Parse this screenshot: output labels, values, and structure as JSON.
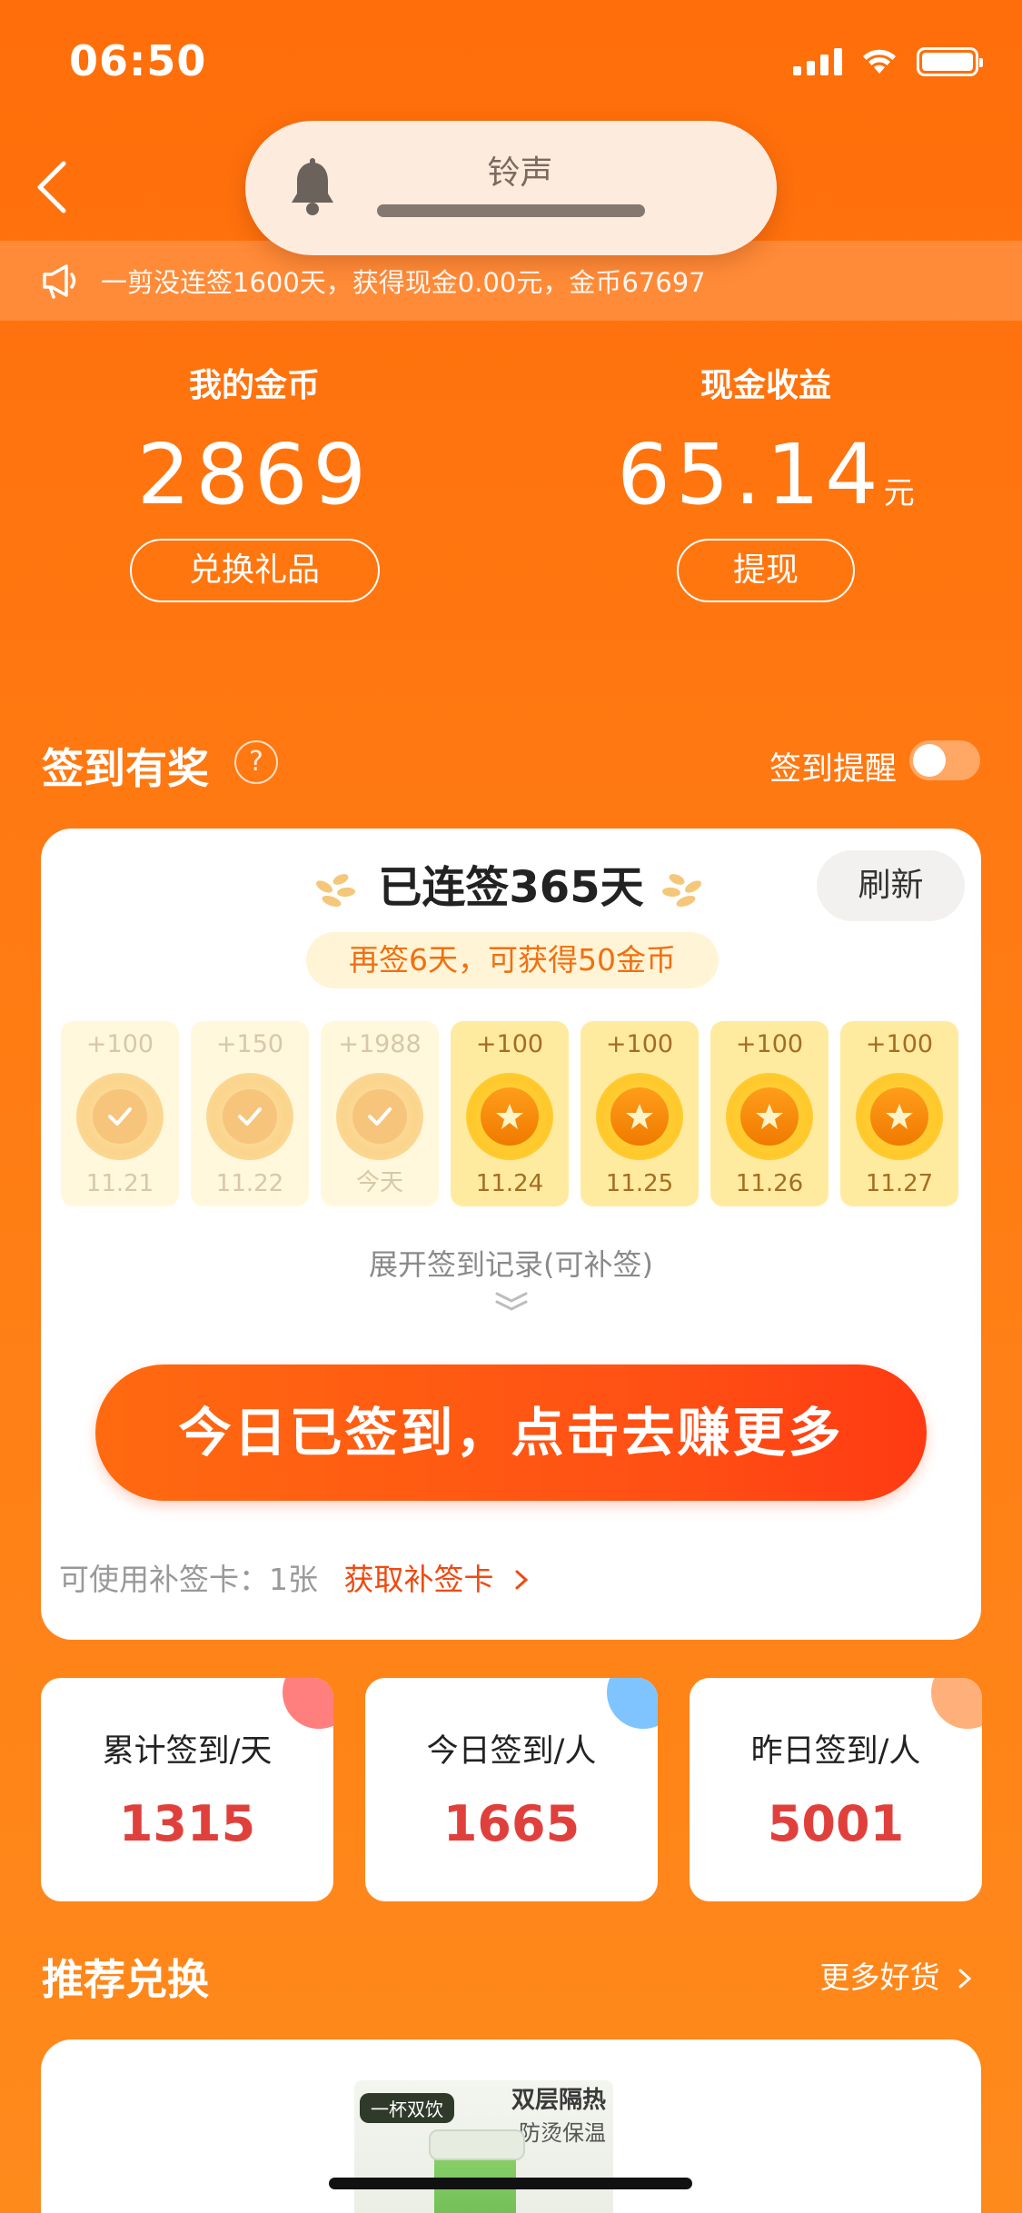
{
  "status_bar": {
    "time": "06:50"
  },
  "ringtone": {
    "label": "铃声",
    "level": 1.0
  },
  "notice": {
    "text": "一剪没连签1600天，获得现金0.00元，金币67697"
  },
  "wallet": {
    "coins_label": "我的金币",
    "coins_value": "2869",
    "exchange_button": "兑换礼品",
    "cash_label": "现金收益",
    "cash_value": "65.14",
    "cash_unit": "元",
    "withdraw_button": "提现"
  },
  "sign_section": {
    "title": "签到有奖",
    "help": "?",
    "reminder_label": "签到提醒",
    "reminder_on": false
  },
  "sign_card": {
    "streak_prefix": "已连签",
    "streak_days": "365天",
    "refresh_button": "刷新",
    "hint": "再签6天，可获得50金币",
    "days": [
      {
        "reward": "+100",
        "date": "11.21",
        "signed": true
      },
      {
        "reward": "+150",
        "date": "11.22",
        "signed": true
      },
      {
        "reward": "+1988",
        "date": "今天",
        "signed": true
      },
      {
        "reward": "+100",
        "date": "11.24",
        "signed": false
      },
      {
        "reward": "+100",
        "date": "11.25",
        "signed": false
      },
      {
        "reward": "+100",
        "date": "11.26",
        "signed": false
      },
      {
        "reward": "+100",
        "date": "11.27",
        "signed": false
      }
    ],
    "expand_text": "展开签到记录(可补签)",
    "cta_button": "今日已签到，点击去赚更多",
    "makeup_label": "可使用补签卡：1张",
    "makeup_link": "获取补签卡"
  },
  "stats": [
    {
      "label": "累计签到/天",
      "value": "1315",
      "accent": "#ff7f7f"
    },
    {
      "label": "今日签到/人",
      "value": "1665",
      "accent": "#7fc4ff"
    },
    {
      "label": "昨日签到/人",
      "value": "5001",
      "accent": "#ffb07a"
    }
  ],
  "recommend": {
    "title": "推荐兑换",
    "more_link": "更多好货",
    "product": {
      "tag": "一杯双饮",
      "title": "双层隔热",
      "subtitle": "防烫保温"
    }
  },
  "colors": {
    "brand": "#ff7410",
    "value_red": "#e0403c",
    "link_red": "#f04a10"
  }
}
